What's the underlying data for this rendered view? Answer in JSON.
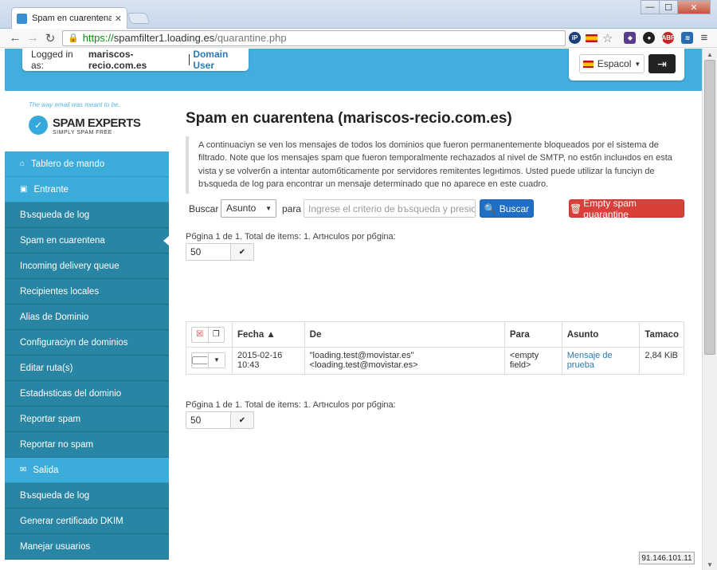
{
  "browser": {
    "tab_title": "Spam en cuarentena (pres",
    "url_https": "https://",
    "url_host": "spamfilter1.loading.es",
    "url_path": "/quarantine.php"
  },
  "header": {
    "logged_label": "Logged in as:",
    "domain": "mariscos-recio.com.es",
    "role": "Domain User",
    "language": "Espacol"
  },
  "logo": {
    "tagline": "The way email was meant to be.",
    "name": "SPAM EXPERTS",
    "subtitle": "SIMPLY SPAM FREE"
  },
  "sidebar": {
    "items": [
      {
        "label": "Tablero de mando",
        "type": "section"
      },
      {
        "label": "Entrante",
        "type": "section"
      },
      {
        "label": "Bъsqueda de log",
        "type": "item"
      },
      {
        "label": "Spam en cuarentena",
        "type": "item",
        "active": true
      },
      {
        "label": "Incoming delivery queue",
        "type": "item"
      },
      {
        "label": "Recipientes locales",
        "type": "item"
      },
      {
        "label": "Alias de Dominio",
        "type": "item"
      },
      {
        "label": "Configuraciуn de dominios",
        "type": "item"
      },
      {
        "label": "Editar ruta(s)",
        "type": "item"
      },
      {
        "label": "Estadнsticas del dominio",
        "type": "item"
      },
      {
        "label": "Reportar spam",
        "type": "item"
      },
      {
        "label": "Reportar no spam",
        "type": "item"
      },
      {
        "label": "Salida",
        "type": "section"
      },
      {
        "label": "Bъsqueda de log",
        "type": "item"
      },
      {
        "label": "Generar certificado DKIM",
        "type": "item"
      },
      {
        "label": "Manejar usuarios",
        "type": "item"
      }
    ]
  },
  "main": {
    "title": "Spam en cuarentena (mariscos-recio.com.es)",
    "note": "A continuaciуn se ven los mensajes de todos los dominios que fueron permanentemente bloqueados por el sistema de filtrado. Note que los mensajes spam que fueron temporalmente rechazados al nivel de SMTP, no estбn incluнdos en esta vista y se volverбn a intentar automбticamente por servidores remitentes legнtimos. Usted puede utilizar la funciуn de bъsqueda de log para encontrar un mensaje determinado que no aparece en este cuadro.",
    "search": {
      "label": "Buscar",
      "field": "Asunto",
      "para": "para",
      "placeholder": "Ingrese el criterio de bъsqueda y presione",
      "button": "Buscar",
      "empty_button": "Empty spam quarantine"
    },
    "pager_text": "Pбgina 1 de 1. Total de items: 1. Artнculos por pбgina:",
    "per_page": "50",
    "table": {
      "headers": [
        "Fecha ▲",
        "De",
        "Para",
        "Asunto",
        "Tamaсo"
      ],
      "rows": [
        {
          "fecha": "2015-02-16 10:43",
          "de": "\"loading.test@movistar.es\" <loading.test@movistar.es>",
          "para": "<empty field>",
          "asunto": "Mensaje de prueba",
          "tamano": "2,84 KiB"
        }
      ]
    }
  },
  "status_ip": "91.146.101.11",
  "colors": {
    "band": "#41aedd",
    "sidebar": "#2985a4",
    "section": "#3cadda",
    "primary": "#1f6fc7",
    "danger": "#d9403a"
  }
}
